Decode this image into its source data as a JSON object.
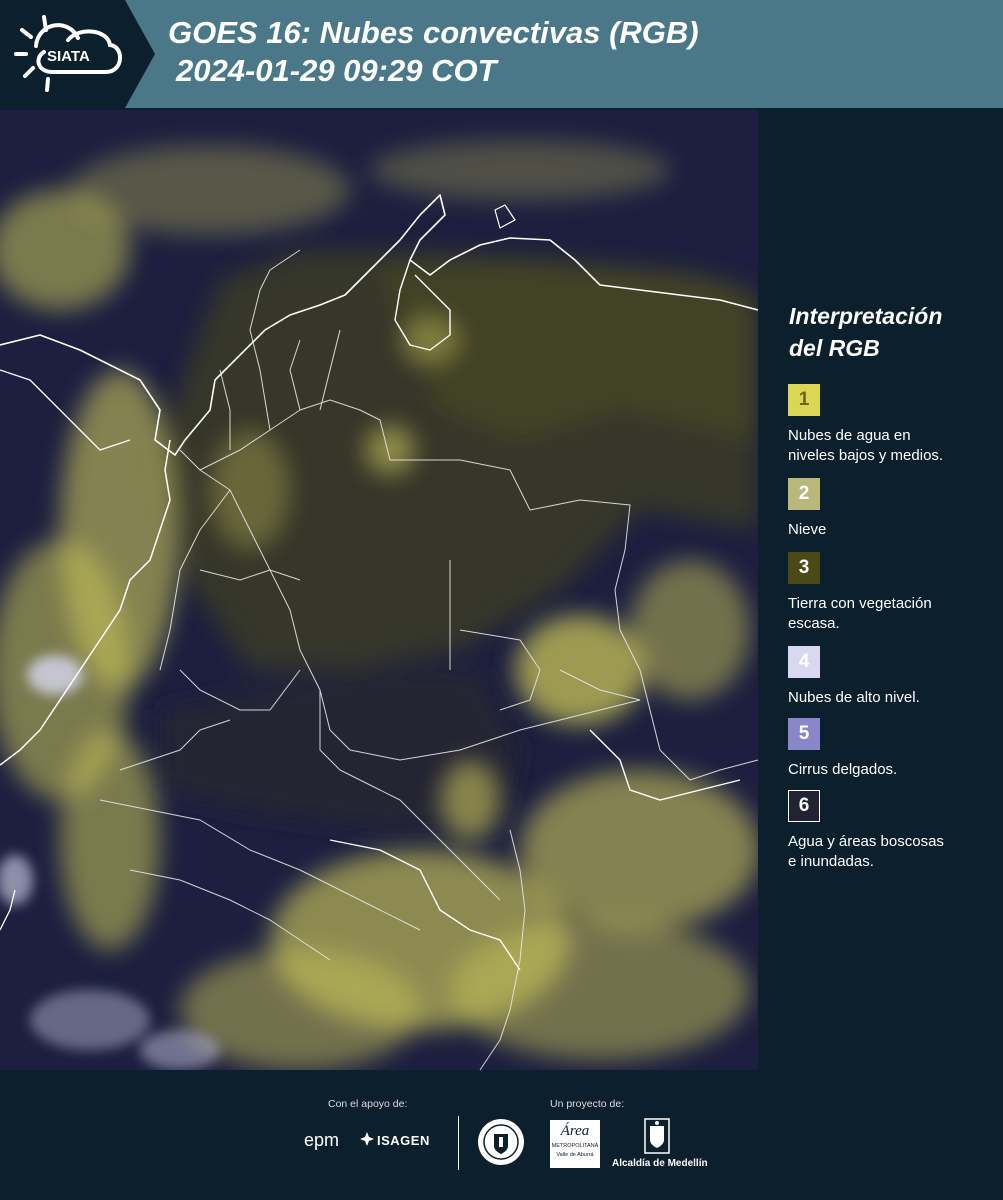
{
  "header": {
    "logo_text": "SIATA",
    "title_line1": "GOES 16: Nubes convectivas (RGB)",
    "title_line2": "2024-01-29 09:29 COT"
  },
  "legend": {
    "title_line1": "Interpretación",
    "title_line2": "del RGB",
    "items": [
      {
        "number": "1",
        "label": "Nubes de agua en\nniveles bajos y medios.",
        "color": "#dcd655",
        "text_color": "#6b6510"
      },
      {
        "number": "2",
        "label": "Nieve",
        "color": "#b9b779",
        "text_color": "#ffffff"
      },
      {
        "number": "3",
        "label": "Tierra con vegetación\nescasa.",
        "color": "#4a4a18",
        "text_color": "#ffffff"
      },
      {
        "number": "4",
        "label": "Nubes de alto nivel.",
        "color": "#d8d8f2",
        "text_color": "#ffffff"
      },
      {
        "number": "5",
        "label": "Cirrus delgados.",
        "color": "#8a87c9",
        "text_color": "#ffffff"
      },
      {
        "number": "6",
        "label": "Agua y áreas boscosas\ne inundadas.",
        "color": "#222235",
        "text_color": "#ffffff"
      }
    ]
  },
  "footer": {
    "support_label": "Con el apoyo de:",
    "project_label": "Un proyecto de:",
    "epm": "epm",
    "isagen": "ISAGEN",
    "metropolitana_name": "Área",
    "metropolitana_sub1": "METROPOLITANA",
    "metropolitana_sub2": "Valle de Aburrá",
    "alcaldia": "Alcaldía de Medellín"
  }
}
